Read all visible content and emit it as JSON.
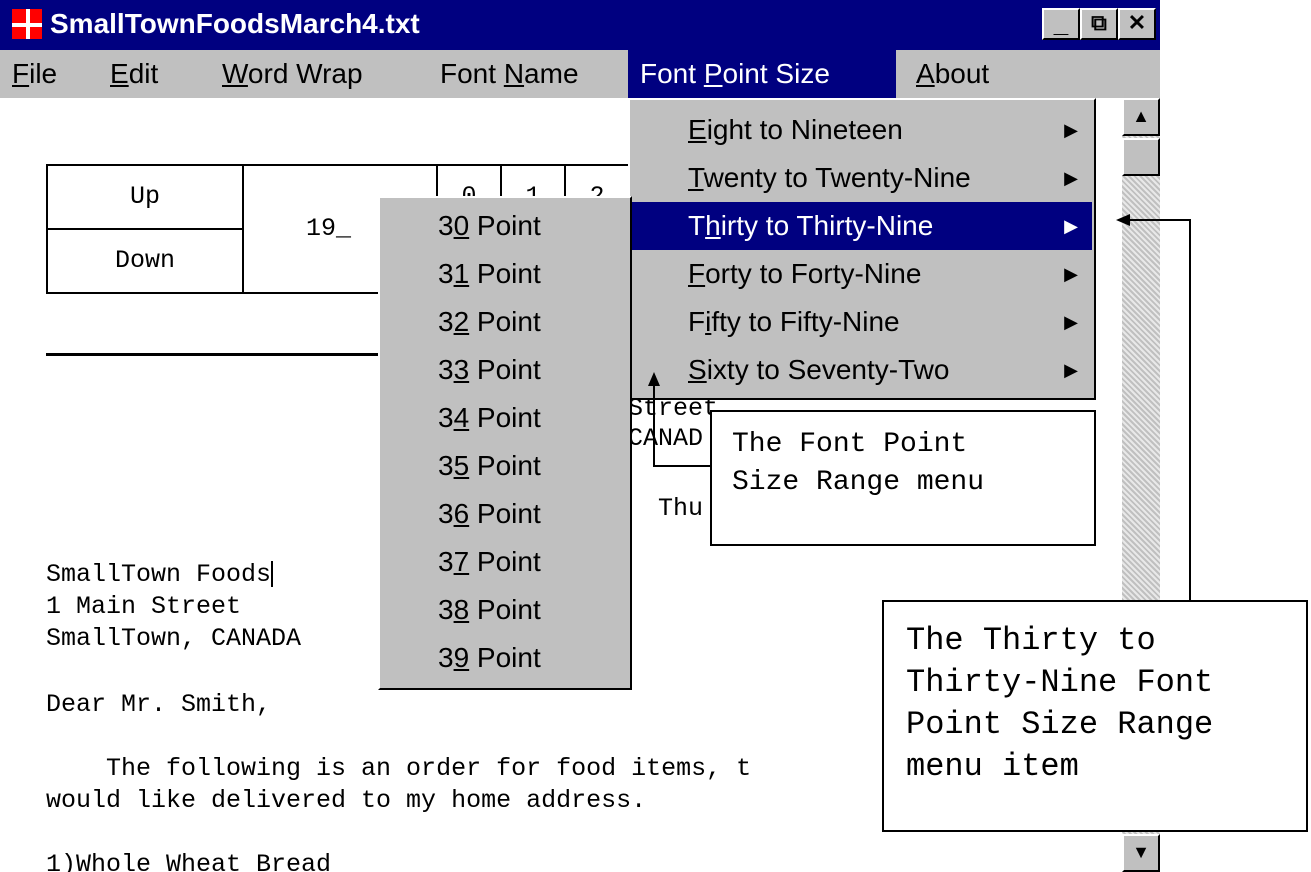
{
  "window": {
    "title": "SmallTownFoodsMarch4.txt",
    "minimize_label": "_",
    "restore_label": "⧉",
    "close_label": "✕"
  },
  "menubar": {
    "items": [
      {
        "pre": "",
        "key": "F",
        "post": "ile"
      },
      {
        "pre": "",
        "key": "E",
        "post": "dit"
      },
      {
        "pre": "",
        "key": "W",
        "post": "ord Wrap"
      },
      {
        "pre": "Font ",
        "key": "N",
        "post": "ame"
      },
      {
        "pre": "Font ",
        "key": "P",
        "post": "oint Size"
      },
      {
        "pre": "",
        "key": "A",
        "post": "bout"
      }
    ]
  },
  "range_menu": {
    "items": [
      {
        "pre": "",
        "key": "E",
        "post": "ight to Nineteen"
      },
      {
        "pre": "",
        "key": "T",
        "post": "wenty to Twenty-Nine"
      },
      {
        "pre": "T",
        "key": "h",
        "post": "irty to Thirty-Nine"
      },
      {
        "pre": "",
        "key": "F",
        "post": "orty to Forty-Nine"
      },
      {
        "pre": "F",
        "key": "i",
        "post": "fty to Fifty-Nine"
      },
      {
        "pre": "",
        "key": "S",
        "post": "ixty to Seventy-Two"
      }
    ]
  },
  "point_menu": {
    "items": [
      {
        "pre": "3",
        "key": "0",
        "post": " Point"
      },
      {
        "pre": "3",
        "key": "1",
        "post": " Point"
      },
      {
        "pre": "3",
        "key": "2",
        "post": " Point"
      },
      {
        "pre": "3",
        "key": "3",
        "post": " Point"
      },
      {
        "pre": "3",
        "key": "4",
        "post": " Point"
      },
      {
        "pre": "3",
        "key": "5",
        "post": " Point"
      },
      {
        "pre": "3",
        "key": "6",
        "post": " Point"
      },
      {
        "pre": "3",
        "key": "7",
        "post": " Point"
      },
      {
        "pre": "3",
        "key": "8",
        "post": " Point"
      },
      {
        "pre": "3",
        "key": "9",
        "post": " Point"
      }
    ]
  },
  "document": {
    "table": {
      "up": "Up",
      "down": "Down",
      "year": "19_",
      "digit0": "0",
      "digit1": "1",
      "digit2": "2"
    },
    "partial_street": "Street",
    "partial_canada": "CANAD",
    "partial_thu": "Thu",
    "address_line1": "SmallTown Foods",
    "address_line2": "1 Main Street",
    "address_line3": "SmallTown, CANADA",
    "greeting": "Dear Mr. Smith,",
    "body_line1": "    The following is an order for food items, t",
    "body_line2": "would like delivered to my home address.",
    "item1": "1)Whole Wheat Bread"
  },
  "callouts": {
    "range_menu_note": "The Font Point\nSize Range menu",
    "menu_item_note": "The Thirty to\nThirty-Nine Font\nPoint Size Range\nmenu item"
  },
  "colors": {
    "titlebar": "#000080",
    "menu_bg": "#c0c0c0",
    "highlight": "#000080"
  }
}
